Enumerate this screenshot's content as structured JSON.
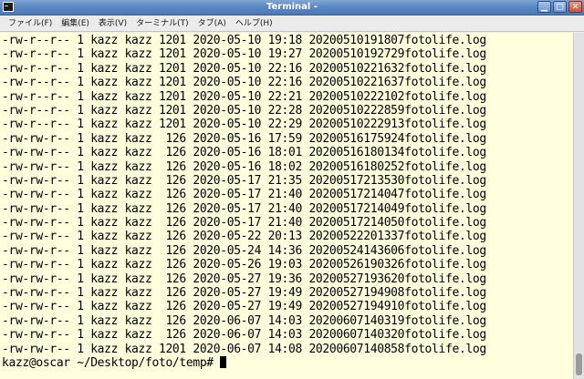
{
  "window": {
    "title": "Terminal -",
    "controls": {
      "minimize": "▁",
      "maximize": "□",
      "close": "✕"
    }
  },
  "menubar": {
    "items": [
      {
        "label": "ファイル(F)"
      },
      {
        "label": "編集(E)"
      },
      {
        "label": "表示(V)"
      },
      {
        "label": "ターミナル(T)"
      },
      {
        "label": "タブ(A)"
      },
      {
        "label": "ヘルプ(H)"
      }
    ]
  },
  "terminal": {
    "colors": {
      "background": "#ffffdd",
      "foreground": "#000000"
    },
    "lines": [
      "-rw-r--r-- 1 kazz kazz 1201 2020-05-10 19:18 20200510191807fotolife.log",
      "-rw-r--r-- 1 kazz kazz 1201 2020-05-10 19:27 20200510192729fotolife.log",
      "-rw-r--r-- 1 kazz kazz 1201 2020-05-10 22:16 20200510221632fotolife.log",
      "-rw-r--r-- 1 kazz kazz 1201 2020-05-10 22:16 20200510221637fotolife.log",
      "-rw-r--r-- 1 kazz kazz 1201 2020-05-10 22:21 20200510222102fotolife.log",
      "-rw-r--r-- 1 kazz kazz 1201 2020-05-10 22:28 20200510222859fotolife.log",
      "-rw-r--r-- 1 kazz kazz 1201 2020-05-10 22:29 20200510222913fotolife.log",
      "-rw-rw-r-- 1 kazz kazz  126 2020-05-16 17:59 20200516175924fotolife.log",
      "-rw-rw-r-- 1 kazz kazz  126 2020-05-16 18:01 20200516180134fotolife.log",
      "-rw-rw-r-- 1 kazz kazz  126 2020-05-16 18:02 20200516180252fotolife.log",
      "-rw-rw-r-- 1 kazz kazz  126 2020-05-17 21:35 20200517213530fotolife.log",
      "-rw-rw-r-- 1 kazz kazz  126 2020-05-17 21:40 20200517214047fotolife.log",
      "-rw-rw-r-- 1 kazz kazz  126 2020-05-17 21:40 20200517214049fotolife.log",
      "-rw-rw-r-- 1 kazz kazz  126 2020-05-17 21:40 20200517214050fotolife.log",
      "-rw-rw-r-- 1 kazz kazz  126 2020-05-22 20:13 20200522201337fotolife.log",
      "-rw-rw-r-- 1 kazz kazz  126 2020-05-24 14:36 20200524143606fotolife.log",
      "-rw-rw-r-- 1 kazz kazz  126 2020-05-26 19:03 20200526190326fotolife.log",
      "-rw-rw-r-- 1 kazz kazz  126 2020-05-27 19:36 20200527193620fotolife.log",
      "-rw-rw-r-- 1 kazz kazz  126 2020-05-27 19:49 20200527194908fotolife.log",
      "-rw-rw-r-- 1 kazz kazz  126 2020-05-27 19:49 20200527194910fotolife.log",
      "-rw-rw-r-- 1 kazz kazz  126 2020-06-07 14:03 20200607140319fotolife.log",
      "-rw-rw-r-- 1 kazz kazz  126 2020-06-07 14:03 20200607140320fotolife.log",
      "-rw-rw-r-- 1 kazz kazz 1201 2020-06-07 14:08 20200607140858fotolife.log"
    ],
    "prompt": "kazz@oscar ~/Desktop/foto/temp# "
  }
}
